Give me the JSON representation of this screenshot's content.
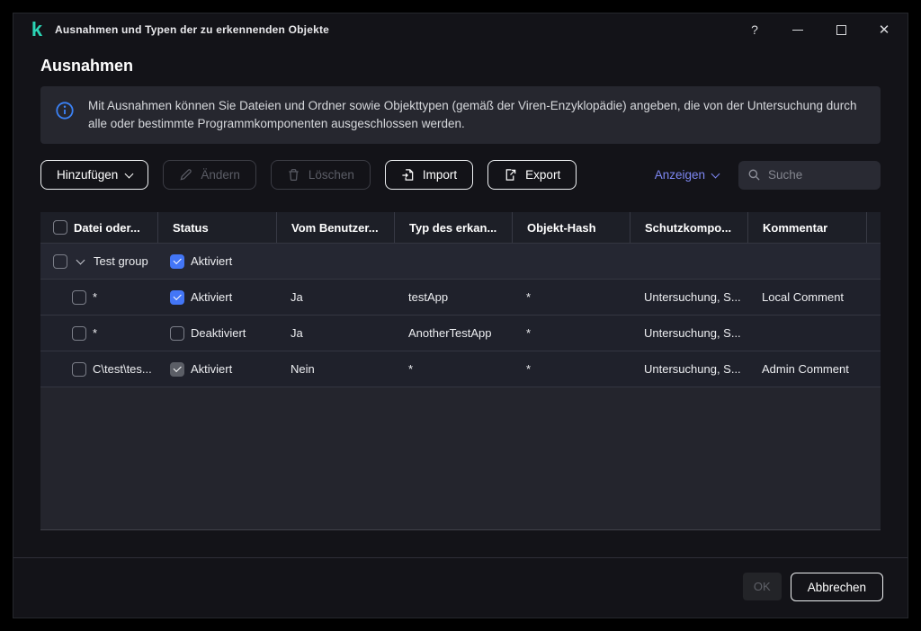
{
  "window": {
    "title": "Ausnahmen und Typen der zu erkennenden Objekte",
    "logo_glyph": "k",
    "help_label": "?"
  },
  "page": {
    "heading": "Ausnahmen",
    "info_text": "Mit Ausnahmen können Sie Dateien und Ordner sowie Objekttypen (gemäß der Viren-Enzyklopädie) angeben, die von der Untersuchung durch alle oder bestimmte Programmkomponenten ausgeschlossen werden."
  },
  "toolbar": {
    "add_label": "Hinzufügen",
    "edit_label": "Ändern",
    "delete_label": "Löschen",
    "import_label": "Import",
    "export_label": "Export",
    "show_label": "Anzeigen",
    "search_placeholder": "Suche"
  },
  "table": {
    "columns": {
      "file": "Datei oder...",
      "status": "Status",
      "user": "Vom Benutzer...",
      "type": "Typ des erkan...",
      "hash": "Objekt-Hash",
      "components": "Schutzkompo...",
      "comment": "Kommentar"
    },
    "group": {
      "name": "Test group",
      "status": "Aktiviert",
      "checked": true,
      "expanded": true
    },
    "rows": [
      {
        "file": "*",
        "status": "Aktiviert",
        "status_checked": true,
        "status_disabled": false,
        "user": "Ja",
        "type": "testApp",
        "hash": "*",
        "components": "Untersuchung, S...",
        "comment": "Local Comment"
      },
      {
        "file": "*",
        "status": "Deaktiviert",
        "status_checked": false,
        "status_disabled": false,
        "user": "Ja",
        "type": "AnotherTestApp",
        "hash": "*",
        "components": "Untersuchung, S...",
        "comment": ""
      },
      {
        "file": "C\\test\\tes...",
        "status": "Aktiviert",
        "status_checked": true,
        "status_disabled": true,
        "user": "Nein",
        "type": "*",
        "hash": "*",
        "components": "Untersuchung, S...",
        "comment": "Admin Comment"
      }
    ]
  },
  "footer": {
    "ok_label": "OK",
    "cancel_label": "Abbrechen"
  },
  "colors": {
    "accent_blue": "#4376f6",
    "link_blue": "#7d87f2",
    "brand_teal": "#2bd4b4",
    "info_blue": "#3b82f6"
  }
}
